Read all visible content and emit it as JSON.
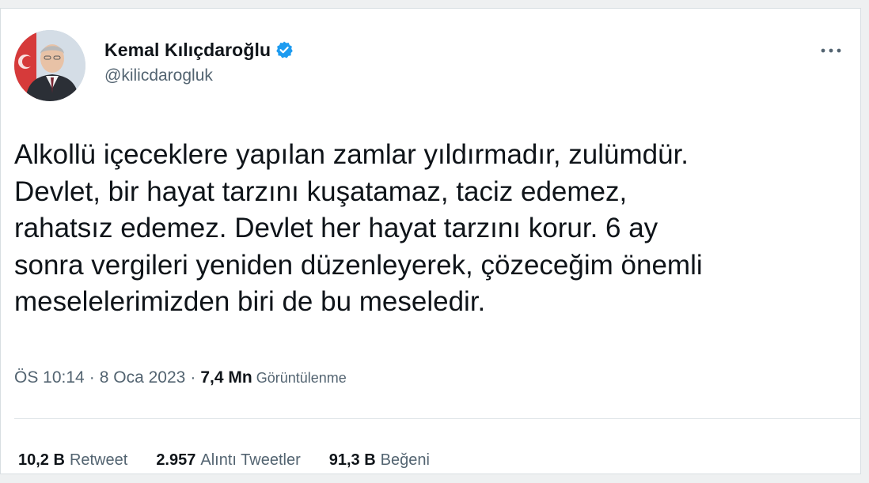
{
  "tweet": {
    "author": {
      "display_name": "Kemal Kılıçdaroğlu",
      "handle": "@kilicdarogluk",
      "verified": true,
      "avatar_icon": "profile-photo"
    },
    "more_icon": "ellipsis-icon",
    "text": "Alkollü içeceklere yapılan zamlar yıldırmadır, zulümdür.\nDevlet, bir hayat tarzını kuşatamaz, taciz edemez,\nrahatsız edemez. Devlet her hayat tarzını korur. 6 ay\nsonra vergileri yeniden düzenleyerek, çözeceğim önemli\nmeselelerimizden biri de bu meseledir.",
    "meta": {
      "time": "ÖS 10:14",
      "separator_1": "·",
      "date": "8 Oca 2023",
      "separator_2": "·",
      "views_count": "7,4 Mn",
      "views_label": "Görüntülenme"
    },
    "stats": {
      "retweets_value": "10,2 B",
      "retweets_label": "Retweet",
      "quotes_value": "2.957",
      "quotes_label": "Alıntı Tweetler",
      "likes_value": "91,3 B",
      "likes_label": "Beğeni"
    },
    "colors": {
      "verified_blue": "#1d9bf0",
      "text_primary": "#0f1419",
      "text_secondary": "#536471"
    }
  }
}
